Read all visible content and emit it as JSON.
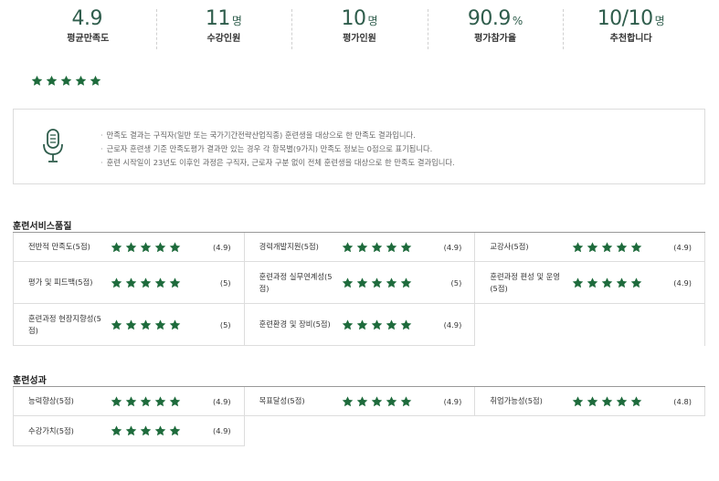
{
  "stats": [
    {
      "value": "4.9",
      "unit": "",
      "label": "평균만족도"
    },
    {
      "value": "11",
      "unit": "명",
      "label": "수강인원"
    },
    {
      "value": "10",
      "unit": "명",
      "label": "평가인원"
    },
    {
      "value": "90.9",
      "unit": "%",
      "label": "평가참가율"
    },
    {
      "value": "10/10",
      "unit": "명",
      "label": "추천합니다"
    }
  ],
  "overall_rating": 4.9,
  "star_color": "#1e6b3c",
  "notice": {
    "icon": "microphone-icon",
    "lines": [
      "만족도 결과는 구직자(일반 또는 국가기간전략산업직종) 훈련생을 대상으로 한 만족도 결과입니다.",
      "근로자 훈련생 기준 만족도평가 결과만 있는 경우 각 항목별(9가지) 만족도 정보는 0점으로 표기됩니다.",
      "훈련 시작일이 23년도 이후인 과정은 구직자, 근로자 구분 없이 전체 훈련생을 대상으로 한 만족도 결과입니다."
    ]
  },
  "service_quality": {
    "title": "훈련서비스품질",
    "items": [
      {
        "name": "전반적 만족도(5점)",
        "score": "(4.9)"
      },
      {
        "name": "경력개발지원(5점)",
        "score": "(4.9)"
      },
      {
        "name": "교강사(5점)",
        "score": "(4.9)"
      },
      {
        "name": "평가 및 피드백(5점)",
        "score": "(5)"
      },
      {
        "name": "훈련과정 실무연계성(5점)",
        "score": "(5)"
      },
      {
        "name": "훈련과정 편성 및 운영(5점)",
        "score": "(4.9)"
      },
      {
        "name": "훈련과정 현장지향성(5점)",
        "score": "(5)"
      },
      {
        "name": "훈련환경 및 장비(5점)",
        "score": "(4.9)"
      }
    ]
  },
  "training_outcome": {
    "title": "훈련성과",
    "items": [
      {
        "name": "능력향상(5점)",
        "score": "(4.9)"
      },
      {
        "name": "목표달성(5점)",
        "score": "(4.9)"
      },
      {
        "name": "취업가능성(5점)",
        "score": "(4.8)"
      },
      {
        "name": "수강가치(5점)",
        "score": "(4.9)"
      }
    ]
  }
}
